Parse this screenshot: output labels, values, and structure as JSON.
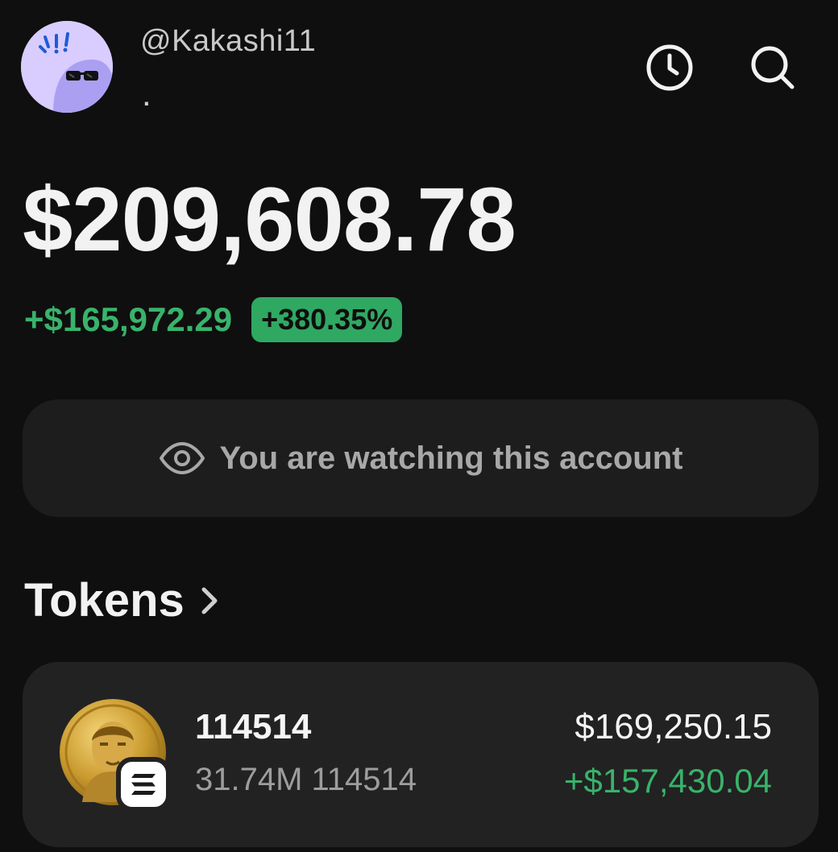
{
  "profile": {
    "handle": "@Kakashi11",
    "sub_text": ".",
    "avatar_icon": "sunglasses-avatar-icon"
  },
  "toolbar": {
    "history_icon": "clock-icon",
    "search_icon": "search-icon"
  },
  "portfolio": {
    "balance": "$209,608.78",
    "change_value": "+$165,972.29",
    "change_percent": "+380.35%",
    "change_color": "#39b36b"
  },
  "watch_banner": {
    "icon": "eye-icon",
    "text": "You are watching this account"
  },
  "tokens_section": {
    "title": "Tokens",
    "chevron_icon": "chevron-right-icon"
  },
  "tokens": [
    {
      "name": "114514",
      "amount": "31.74M 114514",
      "value": "$169,250.15",
      "change": "+$157,430.04",
      "logo_icon": "gold-coin-face-icon",
      "chain_icon": "solana-badge-icon"
    }
  ],
  "colors": {
    "background": "#0f0f0f",
    "card": "#222222",
    "positive": "#39b36b",
    "badge": "#2fa862"
  }
}
